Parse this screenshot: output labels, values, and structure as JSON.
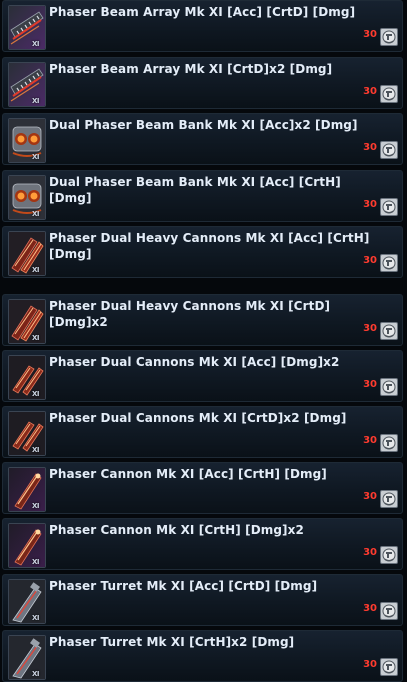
{
  "items": [
    {
      "name": "Phaser Beam Array Mk XI [Acc] [CrtD] [Dmg]",
      "mark": "XI",
      "count": "30",
      "icon": "beam-array-icon"
    },
    {
      "name": "Phaser Beam Array Mk XI [CrtD]x2 [Dmg]",
      "mark": "XI",
      "count": "30",
      "icon": "beam-array-icon"
    },
    {
      "name": "Dual Phaser Beam Bank Mk XI [Acc]x2 [Dmg]",
      "mark": "XI",
      "count": "30",
      "icon": "dual-beam-bank-icon"
    },
    {
      "name": "Dual Phaser Beam Bank Mk XI [Acc] [CrtH] [Dmg]",
      "mark": "XI",
      "count": "30",
      "icon": "dual-beam-bank-icon"
    },
    {
      "name": "Phaser Dual Heavy Cannons Mk XI [Acc] [CrtH] [Dmg]",
      "mark": "XI",
      "count": "30",
      "icon": "dual-heavy-cannons-icon"
    },
    {
      "name": "Phaser Dual Heavy Cannons Mk XI [CrtD] [Dmg]x2",
      "mark": "XI",
      "count": "30",
      "icon": "dual-heavy-cannons-icon"
    },
    {
      "name": "Phaser Dual Cannons Mk XI [Acc] [Dmg]x2",
      "mark": "XI",
      "count": "30",
      "icon": "dual-cannons-icon"
    },
    {
      "name": "Phaser Dual Cannons Mk XI [CrtD]x2 [Dmg]",
      "mark": "XI",
      "count": "30",
      "icon": "dual-cannons-icon"
    },
    {
      "name": "Phaser Cannon Mk XI [Acc] [CrtH] [Dmg]",
      "mark": "XI",
      "count": "30",
      "icon": "cannon-icon"
    },
    {
      "name": "Phaser Cannon Mk XI [CrtH] [Dmg]x2",
      "mark": "XI",
      "count": "30",
      "icon": "cannon-icon"
    },
    {
      "name": "Phaser Turret Mk XI [Acc] [CrtD] [Dmg]",
      "mark": "XI",
      "count": "30",
      "icon": "turret-icon"
    },
    {
      "name": "Phaser Turret Mk XI [CrtH]x2 [Dmg]",
      "mark": "XI",
      "count": "30",
      "icon": "turret-icon"
    }
  ],
  "colors": {
    "count": "#ff3b2f",
    "name": "#e4edf8",
    "row_bg": "#121b26",
    "border": "#1e2a36"
  },
  "token_icon": "dilithium-token-icon"
}
